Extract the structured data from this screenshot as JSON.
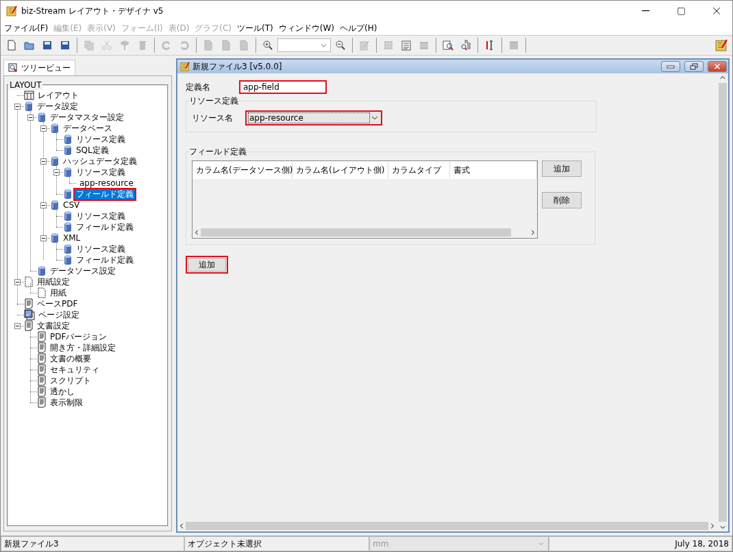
{
  "window": {
    "title": "biz-Stream レイアウト・デザイナ v5"
  },
  "menu": [
    {
      "label": "ファイル(F)",
      "disabled": false
    },
    {
      "label": "編集(E)",
      "disabled": true
    },
    {
      "label": "表示(V)",
      "disabled": true
    },
    {
      "label": "フォーム(I)",
      "disabled": true
    },
    {
      "label": "表(D)",
      "disabled": true
    },
    {
      "label": "グラフ(C)",
      "disabled": true
    },
    {
      "label": "ツール(T)",
      "disabled": false
    },
    {
      "label": "ウィンドウ(W)",
      "disabled": false
    },
    {
      "label": "ヘルプ(H)",
      "disabled": false
    }
  ],
  "toolbar": [
    {
      "kind": "button",
      "disabled": false
    },
    {
      "kind": "button",
      "disabled": false
    },
    {
      "kind": "button",
      "disabled": false
    },
    {
      "kind": "button",
      "disabled": false
    },
    {
      "kind": "separator"
    },
    {
      "kind": "button",
      "disabled": true
    },
    {
      "kind": "button",
      "disabled": true
    },
    {
      "kind": "button",
      "disabled": true
    },
    {
      "kind": "button",
      "disabled": true
    },
    {
      "kind": "separator"
    },
    {
      "kind": "button",
      "disabled": true
    },
    {
      "kind": "button",
      "disabled": true
    },
    {
      "kind": "separator"
    },
    {
      "kind": "button",
      "disabled": true
    },
    {
      "kind": "button",
      "disabled": true
    },
    {
      "kind": "button",
      "disabled": true
    },
    {
      "kind": "separator"
    },
    {
      "kind": "button",
      "disabled": false
    },
    {
      "kind": "combo",
      "disabled": false
    },
    {
      "kind": "button",
      "disabled": false
    },
    {
      "kind": "separator"
    },
    {
      "kind": "button",
      "disabled": true
    },
    {
      "kind": "separator"
    },
    {
      "kind": "button",
      "disabled": true
    },
    {
      "kind": "button",
      "disabled": false
    },
    {
      "kind": "button",
      "disabled": true
    },
    {
      "kind": "separator"
    },
    {
      "kind": "button",
      "disabled": false
    },
    {
      "kind": "button",
      "disabled": false
    },
    {
      "kind": "separator"
    },
    {
      "kind": "button",
      "disabled": false
    },
    {
      "kind": "separator"
    },
    {
      "kind": "button",
      "disabled": true
    },
    {
      "kind": "separator"
    }
  ],
  "left_panel": {
    "tab": {
      "label": "ツリービュー",
      "selected": true
    },
    "group": "LAYOUT",
    "tree": [
      {
        "label": "レイアウト",
        "kind": "layout",
        "selected": false,
        "highlighted": false
      },
      {
        "label": "データ設定",
        "kind": "db",
        "selected": false,
        "highlighted": false,
        "expanded": true,
        "children": [
          {
            "label": "データマスター設定",
            "kind": "db",
            "selected": false,
            "highlighted": false,
            "expanded": true,
            "children": [
              {
                "label": "データベース",
                "kind": "db",
                "selected": false,
                "highlighted": false,
                "expanded": true,
                "children": [
                  {
                    "label": "リソース定義",
                    "kind": "db",
                    "selected": false,
                    "highlighted": false
                  },
                  {
                    "label": "SQL定義",
                    "kind": "db",
                    "selected": false,
                    "highlighted": false
                  }
                ]
              },
              {
                "label": "ハッシュデータ定義",
                "kind": "db",
                "selected": false,
                "highlighted": false,
                "expanded": true,
                "children": [
                  {
                    "label": "リソース定義",
                    "kind": "db",
                    "selected": false,
                    "highlighted": false,
                    "expanded": true,
                    "children": [
                      {
                        "label": "app-resource",
                        "selected": false,
                        "highlighted": false
                      }
                    ]
                  },
                  {
                    "label": "フィールド定義",
                    "kind": "db",
                    "selected": true,
                    "highlighted": true
                  }
                ]
              },
              {
                "label": "CSV",
                "kind": "db",
                "selected": false,
                "highlighted": false,
                "expanded": true,
                "children": [
                  {
                    "label": "リソース定義",
                    "kind": "db",
                    "selected": false,
                    "highlighted": false
                  },
                  {
                    "label": "フィールド定義",
                    "kind": "db",
                    "selected": false,
                    "highlighted": false
                  }
                ]
              },
              {
                "label": "XML",
                "kind": "db",
                "selected": false,
                "highlighted": false,
                "expanded": true,
                "children": [
                  {
                    "label": "リソース定義",
                    "kind": "db",
                    "selected": false,
                    "highlighted": false
                  },
                  {
                    "label": "フィールド定義",
                    "kind": "db",
                    "selected": false,
                    "highlighted": false
                  }
                ]
              }
            ]
          },
          {
            "label": "データソース設定",
            "kind": "db",
            "selected": false,
            "highlighted": false
          }
        ]
      },
      {
        "label": "用紙設定",
        "kind": "paper",
        "selected": false,
        "highlighted": false,
        "expanded": true,
        "children": [
          {
            "label": "用紙",
            "kind": "paper",
            "selected": false,
            "highlighted": false
          }
        ]
      },
      {
        "label": "ベースPDF",
        "kind": "doc",
        "selected": false,
        "highlighted": false
      },
      {
        "label": "ページ設定",
        "kind": "pages",
        "selected": false,
        "highlighted": false
      },
      {
        "label": "文書設定",
        "kind": "doc",
        "selected": false,
        "highlighted": false,
        "expanded": true,
        "children": [
          {
            "label": "PDFバージョン",
            "kind": "doc",
            "selected": false,
            "highlighted": false
          },
          {
            "label": "開き方・詳細設定",
            "kind": "doc",
            "selected": false,
            "highlighted": false
          },
          {
            "label": "文書の概要",
            "kind": "doc",
            "selected": false,
            "highlighted": false
          },
          {
            "label": "セキュリティ",
            "kind": "doc",
            "selected": false,
            "highlighted": false
          },
          {
            "label": "スクリプト",
            "kind": "doc",
            "selected": false,
            "highlighted": false
          },
          {
            "label": "透かし",
            "kind": "doc",
            "selected": false,
            "highlighted": false
          },
          {
            "label": "表示制限",
            "kind": "doc",
            "selected": false,
            "highlighted": false
          }
        ]
      }
    ]
  },
  "document": {
    "title": "新規ファイル3 [v5.0.0]",
    "definition_name": {
      "label": "定義名",
      "value": "app-field",
      "highlighted": true
    },
    "resource_group": {
      "title": "リソース定義",
      "label": "リソース名",
      "value": "app-resource",
      "highlighted": true
    },
    "field_group": {
      "title": "フィールド定義",
      "columns": [
        "カラム名(データソース側)",
        "カラム名(レイアウト側)",
        "カラムタイプ",
        "書式"
      ],
      "buttons": [
        {
          "label": "追加"
        },
        {
          "label": "削除"
        }
      ]
    },
    "add_button": {
      "label": "追加",
      "highlighted": true
    }
  },
  "status_bar": {
    "file": "新規ファイル3",
    "selection": "オブジェクト未選択",
    "unit": {
      "value": "mm",
      "disabled": true
    },
    "date": "July 18, 2018"
  }
}
